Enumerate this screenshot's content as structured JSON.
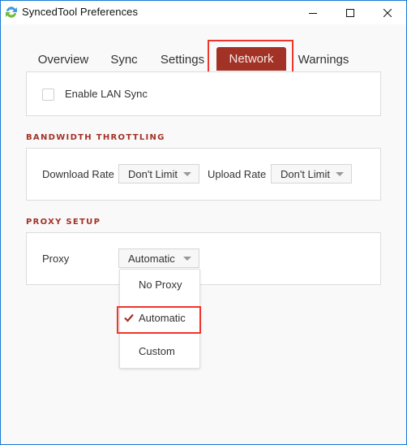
{
  "window": {
    "title": "SyncedTool Preferences",
    "icon": "sync-app-icon",
    "controls": [
      "minimize-icon",
      "maximize-icon",
      "close-icon"
    ]
  },
  "tabs": [
    {
      "label": "Overview",
      "active": false
    },
    {
      "label": "Sync",
      "active": false
    },
    {
      "label": "Settings",
      "active": false
    },
    {
      "label": "Network",
      "active": true,
      "highlighted": true
    },
    {
      "label": "Warnings",
      "active": false
    }
  ],
  "lan": {
    "checkbox_label": "Enable LAN Sync",
    "checked": false
  },
  "bandwidth": {
    "section_title": "BANDWIDTH THROTTLING",
    "download_label": "Download Rate",
    "download_value": "Don't Limit",
    "upload_label": "Upload Rate",
    "upload_value": "Don't Limit"
  },
  "proxy": {
    "section_title": "PROXY SETUP",
    "label": "Proxy",
    "value": "Automatic",
    "dropdown_open": true,
    "options": [
      {
        "label": "No Proxy",
        "selected": false
      },
      {
        "label": "Automatic",
        "selected": true,
        "highlighted": true
      },
      {
        "label": "Custom",
        "selected": false
      }
    ]
  },
  "colors": {
    "accent": "#a33226",
    "highlight_box": "#f0352a",
    "window_border": "#1a7ad4"
  }
}
